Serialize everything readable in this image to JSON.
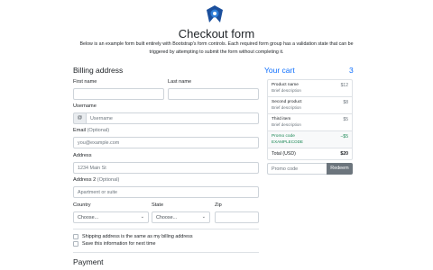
{
  "header": {
    "logo_icon": "bootstrap-logo-icon",
    "title": "Checkout form",
    "lead": "Below is an example form built entirely with Bootstrap's form controls. Each required form group has a validation state that can be triggered by attempting to submit the form without completing it."
  },
  "billing": {
    "heading": "Billing address",
    "first_name": {
      "label": "First name",
      "value": ""
    },
    "last_name": {
      "label": "Last name",
      "value": ""
    },
    "username": {
      "label": "Username",
      "prefix": "@",
      "placeholder": "Username"
    },
    "email": {
      "label": "Email",
      "optional": "(Optional)",
      "placeholder": "you@example.com"
    },
    "address": {
      "label": "Address",
      "placeholder": "1234 Main St"
    },
    "address2": {
      "label": "Address 2",
      "optional": "(Optional)",
      "placeholder": "Apartment or suite"
    },
    "country": {
      "label": "Country",
      "value": "Choose..."
    },
    "state": {
      "label": "State",
      "value": "Choose..."
    },
    "zip": {
      "label": "Zip",
      "value": ""
    },
    "checkbox_same": "Shipping address is the same as my billing address",
    "checkbox_save": "Save this information for next time"
  },
  "payment": {
    "heading": "Payment"
  },
  "cart": {
    "title": "Your cart",
    "count": "3",
    "items": [
      {
        "name": "Product name",
        "desc": "Brief description",
        "price": "$12"
      },
      {
        "name": "Second product",
        "desc": "Brief description",
        "price": "$8"
      },
      {
        "name": "Third item",
        "desc": "Brief description",
        "price": "$5"
      }
    ],
    "promo": {
      "name": "Promo code",
      "code": "EXAMPLECODE",
      "amount": "−$5"
    },
    "total_label": "Total (USD)",
    "total_value": "$20",
    "promo_placeholder": "Promo code",
    "redeem_label": "Redeem"
  },
  "colors": {
    "primary": "#0d6efd",
    "success": "#198754",
    "secondary": "#6c757d",
    "logo": "#1b4f9c"
  }
}
